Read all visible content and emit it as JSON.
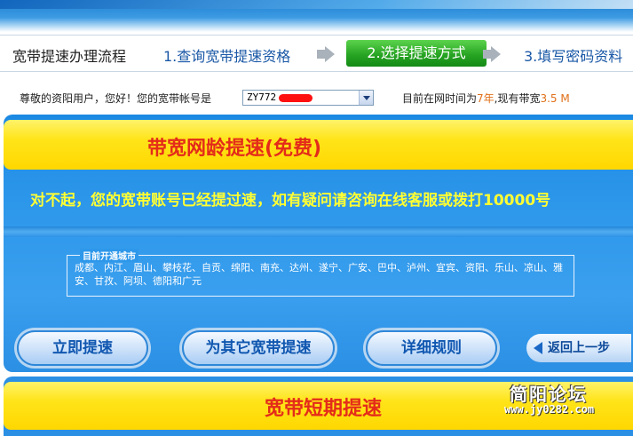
{
  "steps": {
    "title": "宽带提速办理流程",
    "step1": "1.查询宽带提速资格",
    "step2": "2.选择提速方式",
    "step3": "3.填写密码资料"
  },
  "info": {
    "greeting": "尊敬的资阳用户，您好！您的宽带帐号是",
    "account_value": "ZY772",
    "time_prefix": "目前在网时间为",
    "years": "7年",
    "bandwidth_prefix": ",现有带宽",
    "bandwidth": "3.5 M"
  },
  "free_section": {
    "title": "带宽网龄提速(免费)",
    "notice": "对不起，您的宽带账号已经提过速，如有疑问请咨询在线客服或拨打10000号",
    "cities_legend": "目前开通城市",
    "cities": "成都、内江、眉山、攀枝花、自贡、绵阳、南充、达州、遂宁、广安、巴中、泸州、宜宾、资阳、乐山、凉山、雅安、甘孜、阿坝、德阳和广元"
  },
  "buttons": {
    "speed_now": "立即提速",
    "other_account": "为其它宽带提速",
    "rules": "详细规则",
    "back": "返回上一步"
  },
  "short_section": {
    "title": "宽带短期提速"
  },
  "watermark": {
    "name": "简阳论坛",
    "url": "www.jy0282.com"
  },
  "colors": {
    "accent_blue": "#2d97ea",
    "yellow": "#ffe419",
    "title_red": "#e42b1a",
    "step_active_green": "#28a523",
    "highlight_orange": "#e0701a"
  }
}
